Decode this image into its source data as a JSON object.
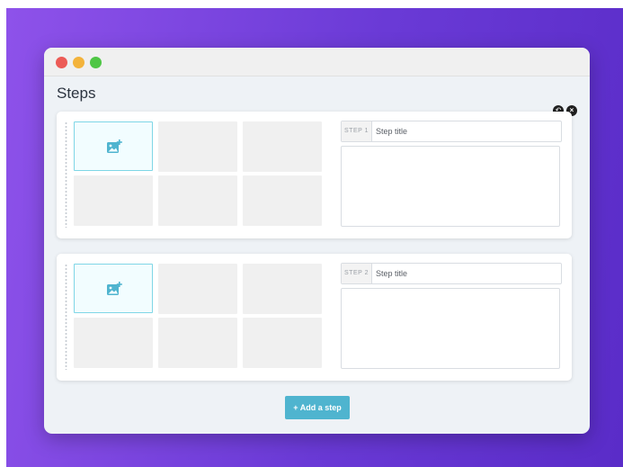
{
  "page": {
    "title": "Steps"
  },
  "colors": {
    "accent": "#4fb4cf",
    "tile_border": "#7fd6e6",
    "window_red": "#ec5b56",
    "window_yellow": "#f3b33b",
    "window_green": "#4fc645"
  },
  "step_actions": {
    "undo_icon": "undo-icon",
    "close_icon": "close-icon"
  },
  "steps": [
    {
      "badge": "STEP 1",
      "title_placeholder": "Step title",
      "add_image_icon": "add-image-icon"
    },
    {
      "badge": "STEP 2",
      "title_placeholder": "Step title",
      "add_image_icon": "add-image-icon"
    }
  ],
  "add_step_button": {
    "label": "+ Add a step"
  }
}
